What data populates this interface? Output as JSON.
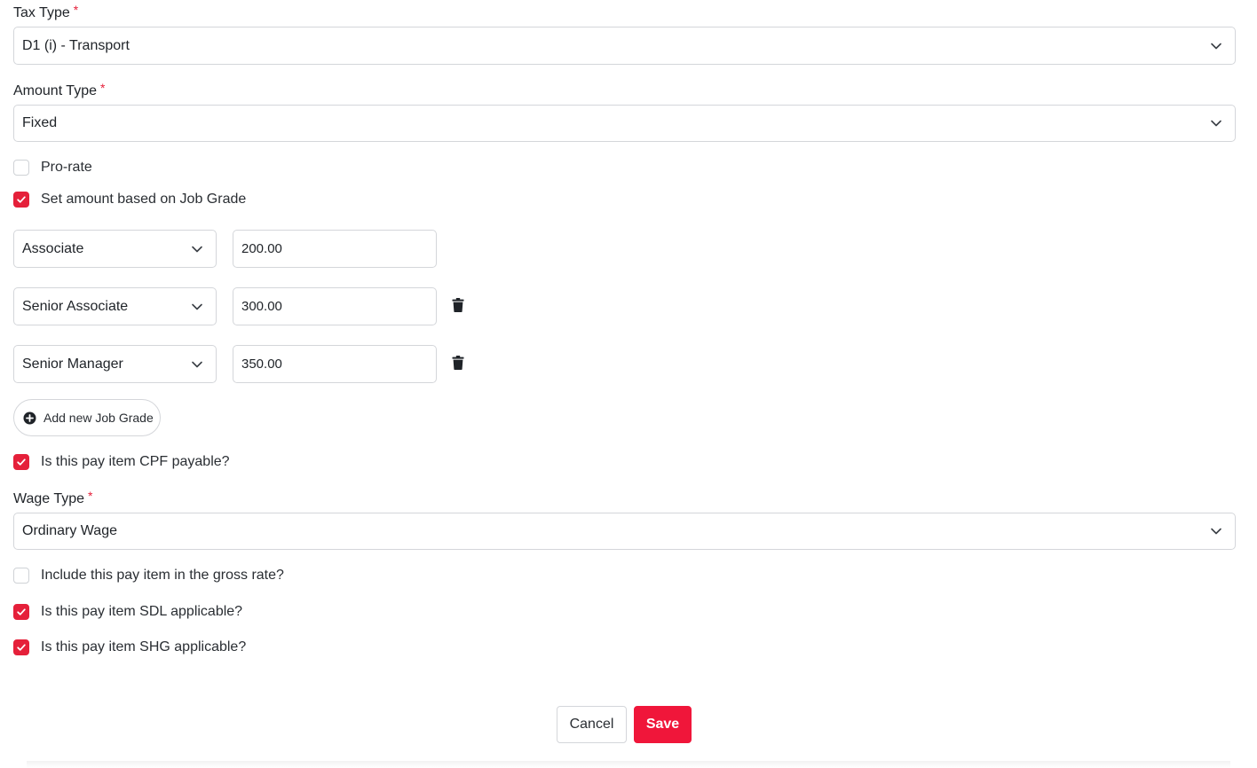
{
  "tax_type": {
    "label": "Tax Type",
    "required_mark": "*",
    "value": "D1 (i) - Transport"
  },
  "amount_type": {
    "label": "Amount Type",
    "required_mark": "*",
    "value": "Fixed"
  },
  "pro_rate": {
    "label": "Pro-rate",
    "checked": false
  },
  "job_grade_toggle": {
    "label": "Set amount based on Job Grade",
    "checked": true
  },
  "job_grades": [
    {
      "grade": "Associate",
      "amount": "200.00",
      "deletable": false
    },
    {
      "grade": "Senior Associate",
      "amount": "300.00",
      "deletable": true
    },
    {
      "grade": "Senior Manager",
      "amount": "350.00",
      "deletable": true
    }
  ],
  "add_job_grade": {
    "label": "Add new Job Grade",
    "icon": "plus-circle-icon"
  },
  "cpf_payable": {
    "label": "Is this pay item CPF payable?",
    "checked": true
  },
  "wage_type": {
    "label": "Wage Type",
    "required_mark": "*",
    "value": "Ordinary Wage"
  },
  "gross_rate": {
    "label": "Include this pay item in the gross rate?",
    "checked": false
  },
  "sdl_applicable": {
    "label": "Is this pay item SDL applicable?",
    "checked": true
  },
  "shg_applicable": {
    "label": "Is this pay item SHG applicable?",
    "checked": true
  },
  "actions": {
    "cancel_label": "Cancel",
    "save_label": "Save"
  },
  "colors": {
    "accent": "#e5203a",
    "save_button": "#f0163a",
    "border": "#d4d6da"
  },
  "icons": {
    "select_arrow": "chevron-down-icon",
    "delete": "trash-icon",
    "check": "check-icon"
  }
}
